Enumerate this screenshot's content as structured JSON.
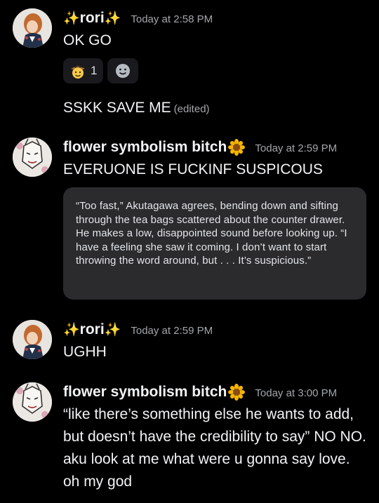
{
  "messages": [
    {
      "username": "rori",
      "username_decor_left": "✨",
      "username_decor_right": "✨",
      "timestamp": "Today at 2:58 PM",
      "lines": [
        "OK GO"
      ],
      "reactions": [
        {
          "icon": "cowboy-emoji-icon",
          "count": "1"
        },
        {
          "icon": "add-reaction-icon"
        }
      ],
      "followup": {
        "text": "SSKK SAVE ME",
        "edited_label": "(edited)"
      }
    },
    {
      "username": "flower symbolism bitch",
      "badge": "sunflower-icon",
      "timestamp": "Today at 2:59 PM",
      "lines": [
        "EVERUONE IS FUCKINF SUSPICOUS"
      ],
      "quote": "“Too fast,” Akutagawa agrees, bending down and sifting through the tea bags scattered about the counter drawer. He makes a low, disappointed sound before looking up. “I have a feeling she saw it coming. I don’t want to start throwing the word around, but . . . It’s suspicious.”"
    },
    {
      "username": "rori",
      "username_decor_left": "✨",
      "username_decor_right": "✨",
      "timestamp": "Today at 2:59 PM",
      "lines": [
        "UGHH"
      ]
    },
    {
      "username": "flower symbolism bitch",
      "badge": "sunflower-icon",
      "timestamp": "Today at 3:00 PM",
      "lines": [
        "“like there’s something else he wants to add, but doesn’t have the credibility to say” NO NO. aku look at me what were u gonna say love. oh my god"
      ]
    }
  ],
  "colors": {
    "background": "#000000",
    "text": "#f2f3f5",
    "muted": "#a3a6aa",
    "quote_bg": "#2b2b2e",
    "reaction_bg": "#1a1a1e"
  }
}
